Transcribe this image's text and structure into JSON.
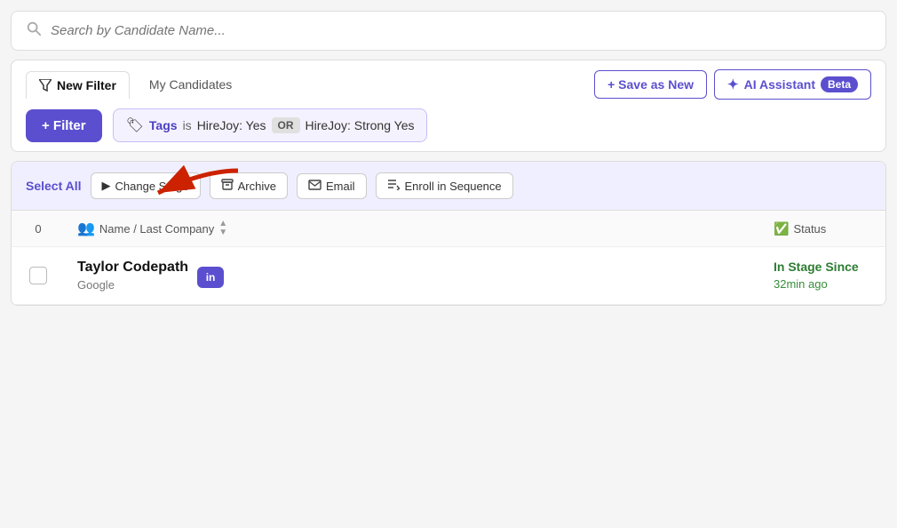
{
  "search": {
    "placeholder": "Search by Candidate Name..."
  },
  "tabs": {
    "new_filter_label": "New Filter",
    "my_candidates_label": "My Candidates"
  },
  "buttons": {
    "save_as_new": "+ Save as New",
    "ai_assistant": "AI Assistant",
    "beta_badge": "Beta",
    "filter": "+ Filter",
    "change_stage": "Change Stage",
    "archive": "Archive",
    "email": "Email",
    "enroll": "Enroll in Sequence",
    "select_all": "Select All"
  },
  "filter_pill": {
    "icon": "🏷",
    "label": "Tags",
    "operator": "is",
    "value1": "HireJoy: Yes",
    "or_badge": "OR",
    "value2": "HireJoy: Strong Yes"
  },
  "table": {
    "columns": [
      {
        "id": "count",
        "label": "0"
      },
      {
        "id": "name",
        "label": "Name / Last Company",
        "icon": "👥"
      },
      {
        "id": "status",
        "label": "Status",
        "icon": "✅"
      }
    ],
    "rows": [
      {
        "name": "Taylor Codepath",
        "company": "Google",
        "linkedin": "in",
        "status_label": "In Stage Since",
        "status_time": "32min ago"
      }
    ]
  },
  "icons": {
    "search": "🔍",
    "filter_funnel": "⛉",
    "sparkle": "✦",
    "archive": "▭",
    "email": "✉",
    "enroll": "≡",
    "stage": "▶"
  }
}
